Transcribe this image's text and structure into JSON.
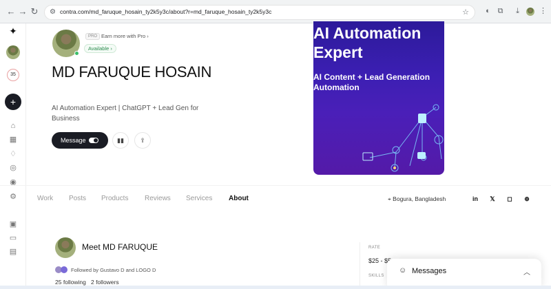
{
  "browser": {
    "url": "contra.com/md_faruque_hosain_ty2k5y3c/about?r=md_faruque_hosain_ty2k5y3c",
    "back_icon": "back-arrow-icon",
    "forward_icon": "forward-arrow-icon",
    "reload_icon": "reload-icon"
  },
  "sidebar": {
    "count_badge": "35"
  },
  "profile": {
    "pro_badge": "PRO",
    "earn_label": "Earn more with Pro",
    "availability": "Available",
    "name": "MD FARUQUE HOSAIN",
    "tagline": "AI Automation Expert | ChatGPT + Lead Gen for Business",
    "message_button": "Message"
  },
  "banner": {
    "title": "AI Automation\nExpert",
    "subtitle": "AI Content + Lead Generation\nAutomation"
  },
  "tabs": [
    {
      "label": "Work",
      "active": false
    },
    {
      "label": "Posts",
      "active": false
    },
    {
      "label": "Products",
      "active": false
    },
    {
      "label": "Reviews",
      "active": false
    },
    {
      "label": "Services",
      "active": false
    },
    {
      "label": "About",
      "active": true
    }
  ],
  "location": "Bogura, Bangladesh",
  "about": {
    "heading": "Meet MD FARUQUE",
    "followed_by": "Followed by Gustavo D and LOGO D",
    "following": "25 following",
    "followers": "2 followers"
  },
  "rate_card": {
    "rate_label": "RATE",
    "rate_value": "$25 - $5",
    "skills_label": "SKILLS"
  },
  "messages_panel": {
    "title": "Messages"
  },
  "colors": {
    "accent_dark": "#1a1c24",
    "available_green": "#2b8c4e",
    "banner_purple": "#3c1fb3"
  }
}
